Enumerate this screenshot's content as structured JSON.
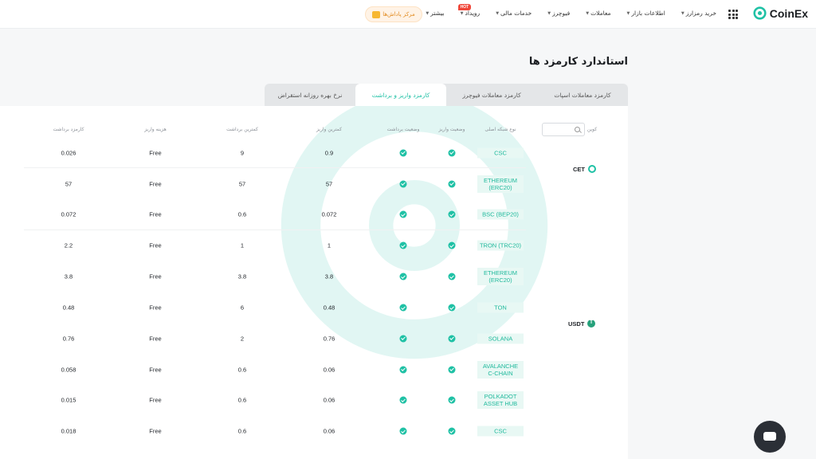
{
  "header": {
    "brand": "CoinEx",
    "nav": [
      {
        "label": "خرید رمزارز",
        "caret": true,
        "hot": false
      },
      {
        "label": "اطلاعات بازار",
        "caret": true,
        "hot": false
      },
      {
        "label": "معاملات",
        "caret": true,
        "hot": false
      },
      {
        "label": "فیوچرز",
        "caret": true,
        "hot": false
      },
      {
        "label": "خدمات مالی",
        "caret": true,
        "hot": false
      },
      {
        "label": "رویداد",
        "caret": true,
        "hot": true
      },
      {
        "label": "بیشتر",
        "caret": true,
        "hot": false
      }
    ],
    "hot_badge": "HOT",
    "rewards_label": "مرکز پاداش‌ها"
  },
  "page": {
    "title": "استاندارد کارمزد ها",
    "tabs": [
      {
        "label": "کارمزد معاملات اسپات",
        "active": false
      },
      {
        "label": "کارمزد معاملات فیوچرز",
        "active": false
      },
      {
        "label": "کارمزد واریز و برداشت",
        "active": true
      },
      {
        "label": "نرخ بهره روزانه استقراض",
        "active": false
      }
    ]
  },
  "table": {
    "headers": {
      "coin": "کوین",
      "network": "نوع شبکه اصلی",
      "deposit_status": "وضعیت واریز",
      "withdraw_status": "وضعیت برداشت",
      "min_deposit": "کمترین واریز",
      "min_withdraw": "کمترین برداشت",
      "deposit_fee": "هزینه واریز",
      "withdraw_fee": "کارمزد برداشت"
    },
    "coins": [
      {
        "name": "CET"
      },
      {
        "name": "USDT"
      }
    ],
    "rows": [
      {
        "network": "CSC",
        "min_deposit": "0.9",
        "min_withdraw": "9",
        "deposit_fee": "Free",
        "withdraw_fee": "0.026"
      },
      {
        "network": "ETHEREUM (ERC20)",
        "min_deposit": "57",
        "min_withdraw": "57",
        "deposit_fee": "Free",
        "withdraw_fee": "57"
      },
      {
        "network": "BSC (BEP20)",
        "min_deposit": "0.072",
        "min_withdraw": "0.6",
        "deposit_fee": "Free",
        "withdraw_fee": "0.072"
      },
      {
        "network": "TRON (TRC20)",
        "min_deposit": "1",
        "min_withdraw": "1",
        "deposit_fee": "Free",
        "withdraw_fee": "2.2"
      },
      {
        "network": "ETHEREUM (ERC20)",
        "min_deposit": "3.8",
        "min_withdraw": "3.8",
        "deposit_fee": "Free",
        "withdraw_fee": "3.8"
      },
      {
        "network": "TON",
        "min_deposit": "0.48",
        "min_withdraw": "6",
        "deposit_fee": "Free",
        "withdraw_fee": "0.48"
      },
      {
        "network": "SOLANA",
        "min_deposit": "0.76",
        "min_withdraw": "2",
        "deposit_fee": "Free",
        "withdraw_fee": "0.76"
      },
      {
        "network": "AVALANCHE C-CHAIN",
        "min_deposit": "0.06",
        "min_withdraw": "0.6",
        "deposit_fee": "Free",
        "withdraw_fee": "0.058"
      },
      {
        "network": "POLKADOT ASSET HUB",
        "min_deposit": "0.06",
        "min_withdraw": "0.6",
        "deposit_fee": "Free",
        "withdraw_fee": "0.015"
      },
      {
        "network": "CSC",
        "min_deposit": "0.06",
        "min_withdraw": "0.6",
        "deposit_fee": "Free",
        "withdraw_fee": "0.018"
      }
    ]
  },
  "colors": {
    "accent": "#1fc1a5",
    "brand_dark": "#1a1d21"
  }
}
